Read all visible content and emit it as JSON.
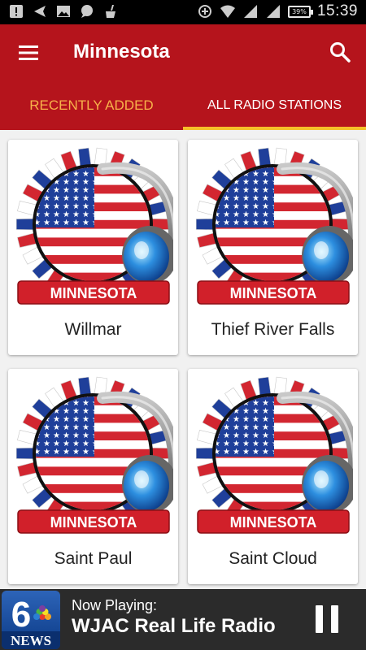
{
  "status_bar": {
    "time": "15:39",
    "battery": "39%",
    "icons": [
      "notification-alert-icon",
      "send-icon",
      "image-icon",
      "chat-icon",
      "cleaner-icon",
      "data-saver-icon",
      "wifi-icon",
      "signal-icon",
      "signal-icon"
    ]
  },
  "app_bar": {
    "title": "Minnesota",
    "menu_icon": "hamburger-menu-icon",
    "search_icon": "search-icon",
    "color": "#b5141c"
  },
  "tabs": [
    {
      "label": "RECENTLY ADDED",
      "active": false
    },
    {
      "label": "ALL RADIO STATIONS",
      "active": true
    }
  ],
  "logo_text": "MINNESOTA",
  "stations": [
    {
      "name": "Willmar"
    },
    {
      "name": "Thief River Falls"
    },
    {
      "name": "Saint Paul"
    },
    {
      "name": "Saint Cloud"
    }
  ],
  "now_playing": {
    "status": "Now Playing:",
    "station": "WJAC Real Life Radio",
    "logo_number": "6",
    "logo_text": "NEWS",
    "control_icon": "pause-icon"
  },
  "colors": {
    "accent": "#f5c02a",
    "tab_inactive": "#f7b24a",
    "player_bg": "#2b2b2b"
  }
}
